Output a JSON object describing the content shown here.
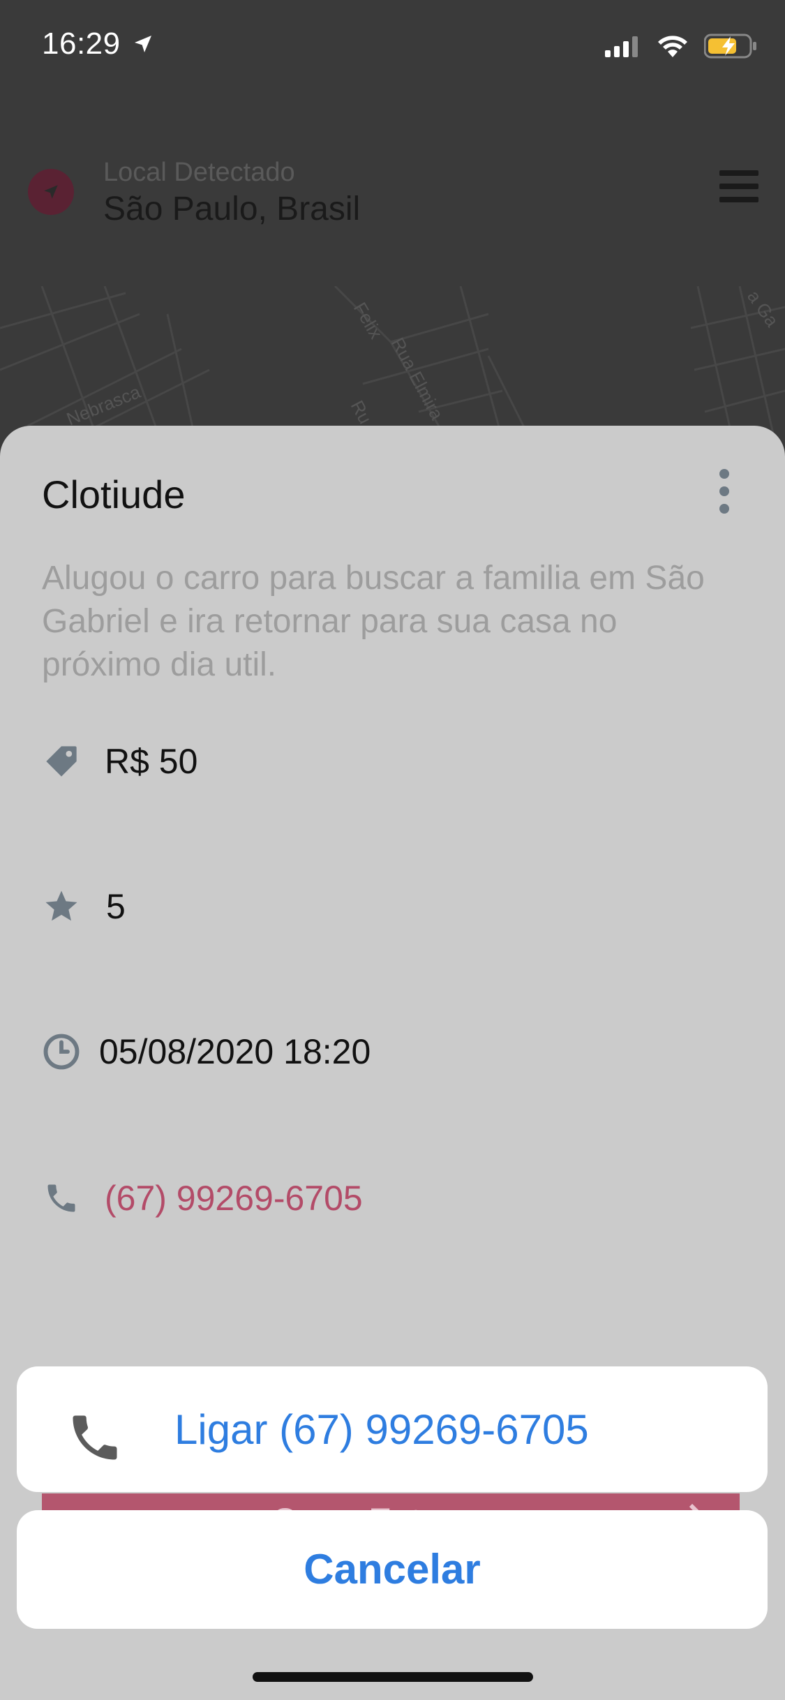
{
  "status_bar": {
    "time": "16:29",
    "icons": [
      "location-arrow-icon",
      "signal-icon",
      "wifi-icon",
      "battery-charging-icon"
    ]
  },
  "header": {
    "location_label": "Local Detectado",
    "location_value": "São Paulo, Brasil",
    "icons": [
      "location-arrow-icon",
      "hamburger-menu-icon"
    ]
  },
  "map": {
    "street_labels": [
      "Felix",
      "Rua Elmira",
      "Ru",
      "Nebrasca",
      "a Ga"
    ]
  },
  "detail": {
    "name": "Clotiude",
    "description": "Alugou o carro para buscar a familia em São Gabriel e ira retornar para sua casa no próximo dia util.",
    "price": "R$ 50",
    "rating": "5",
    "datetime": "05/08/2020 18:20",
    "phone": "(67) 99269-6705",
    "delivered_button": "Carro Entregue"
  },
  "action_sheet": {
    "call_label": "Ligar (67) 99269-6705",
    "cancel_label": "Cancelar"
  },
  "colors": {
    "accent_blue": "#2e7de0",
    "phone_pink": "#b34b68",
    "button_pink": "#b4566e",
    "icon_gray": "#6d7983"
  }
}
